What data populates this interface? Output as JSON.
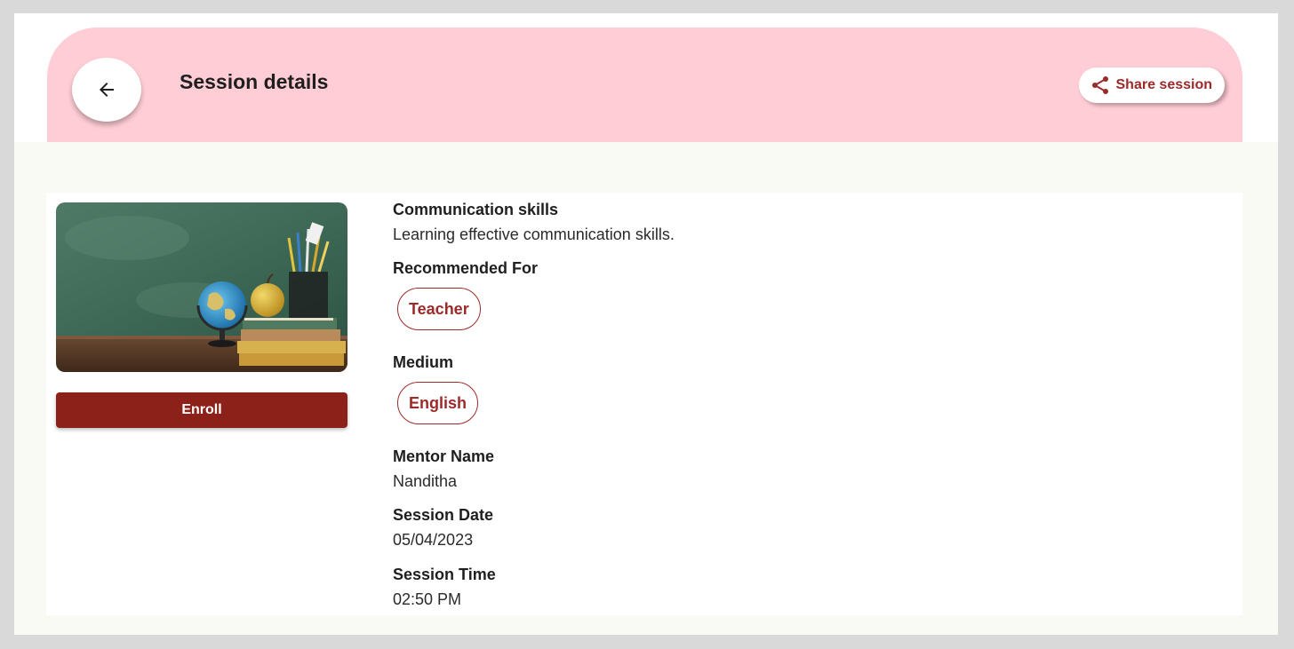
{
  "header": {
    "title": "Session details",
    "share_label": "Share session",
    "back_icon": "arrow-left-icon",
    "share_icon": "share-icon"
  },
  "session": {
    "title": "Communication skills",
    "description": "Learning effective communication skills.",
    "enroll_label": "Enroll",
    "recommended_for_label": "Recommended For",
    "recommended_for": [
      "Teacher"
    ],
    "medium_label": "Medium",
    "medium": [
      "English"
    ],
    "mentor_label": "Mentor Name",
    "mentor": "Nanditha",
    "date_label": "Session Date",
    "date": "05/04/2023",
    "time_label": "Session Time",
    "time": "02:50 PM"
  },
  "colors": {
    "header_bg": "#ffcdd5",
    "accent": "#8b2119",
    "chip": "#9d2a2a",
    "page_bg": "#fafaf5"
  }
}
